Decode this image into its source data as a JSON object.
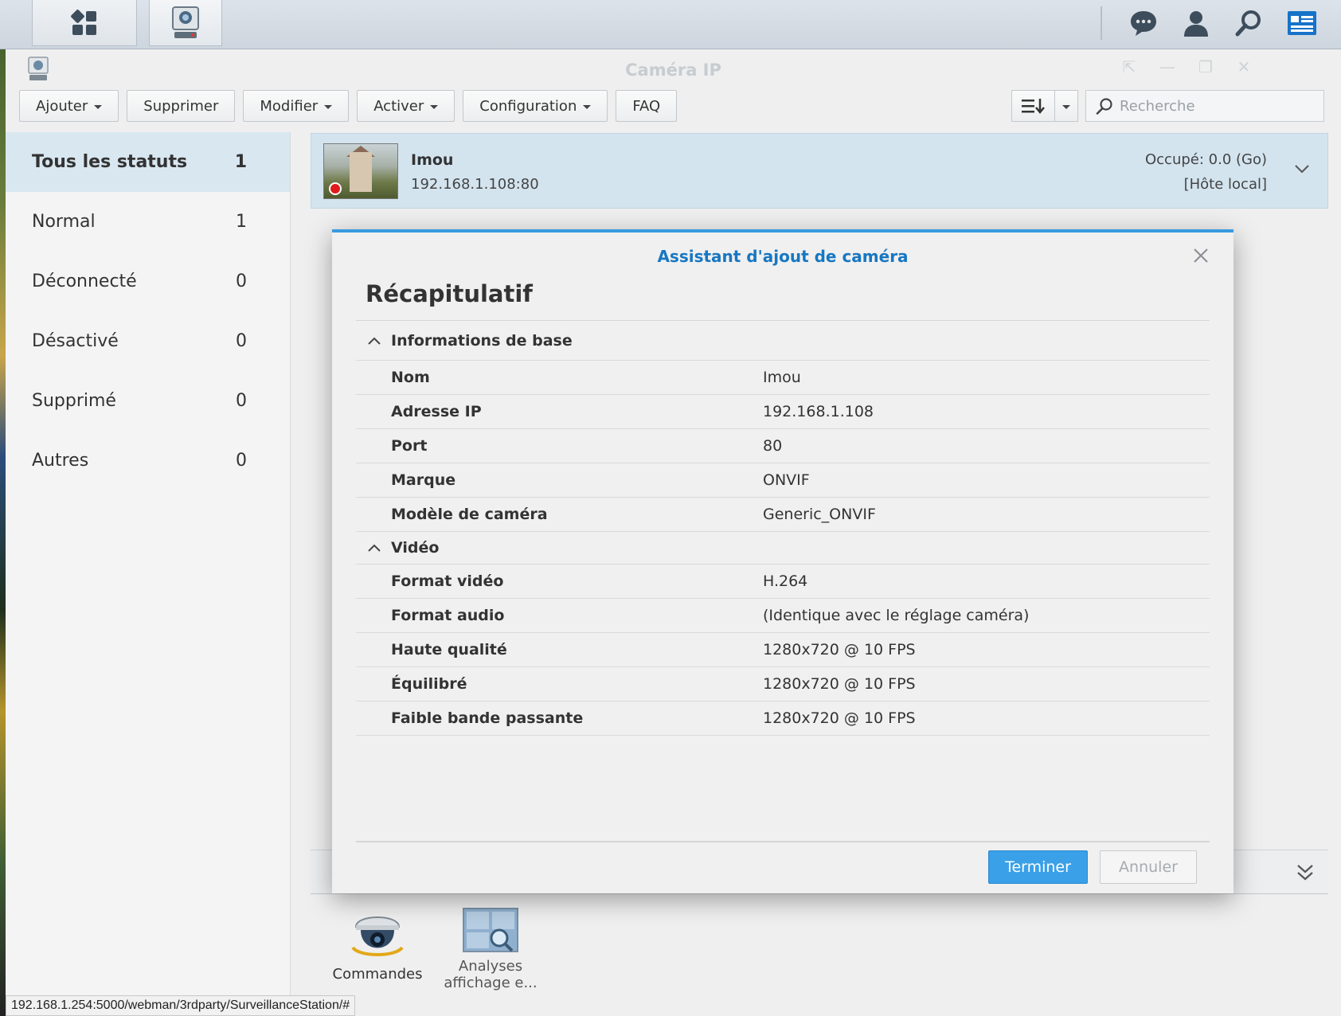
{
  "window": {
    "title": "Caméra IP"
  },
  "toolbar": {
    "add": "Ajouter",
    "delete": "Supprimer",
    "edit": "Modifier",
    "enable": "Activer",
    "config": "Configuration",
    "faq": "FAQ",
    "search_placeholder": "Recherche"
  },
  "sidebar": {
    "items": [
      {
        "label": "Tous les statuts",
        "count": "1"
      },
      {
        "label": "Normal",
        "count": "1"
      },
      {
        "label": "Déconnecté",
        "count": "0"
      },
      {
        "label": "Désactivé",
        "count": "0"
      },
      {
        "label": "Supprimé",
        "count": "0"
      },
      {
        "label": "Autres",
        "count": "0"
      }
    ]
  },
  "camera": {
    "name": "Imou",
    "address": "192.168.1.108:80",
    "used": "Occupé: 0.0 (Go)",
    "host": "[Hôte local]"
  },
  "wizard": {
    "title": "Assistant d'ajout de caméra",
    "heading": "Récapitulatif",
    "section_basic": "Informations de base",
    "basic": [
      {
        "k": "Nom",
        "v": "Imou"
      },
      {
        "k": "Adresse IP",
        "v": "192.168.1.108"
      },
      {
        "k": "Port",
        "v": "80"
      },
      {
        "k": "Marque",
        "v": "ONVIF"
      },
      {
        "k": "Modèle de caméra",
        "v": "Generic_ONVIF"
      }
    ],
    "section_video": "Vidéo",
    "video": [
      {
        "k": "Format vidéo",
        "v": "H.264"
      },
      {
        "k": "Format audio",
        "v": "(Identique avec le réglage caméra)"
      },
      {
        "k": "Haute qualité",
        "v": "1280x720 @ 10 FPS"
      },
      {
        "k": "Équilibré",
        "v": "1280x720 @ 10 FPS"
      },
      {
        "k": "Faible bande passante",
        "v": "1280x720 @ 10 FPS"
      }
    ],
    "finish": "Terminer",
    "cancel": "Annuler"
  },
  "apps": {
    "ptz": "Commandes PTZ",
    "analytics_1": "Analyses",
    "analytics_2": "affichage e..."
  },
  "status_url": "192.168.1.254:5000/webman/3rdparty/SurveillanceStation/#",
  "colors": {
    "accent": "#3a9ae0",
    "title_blue": "#1777c2",
    "selected_row": "#d3e4ef"
  }
}
